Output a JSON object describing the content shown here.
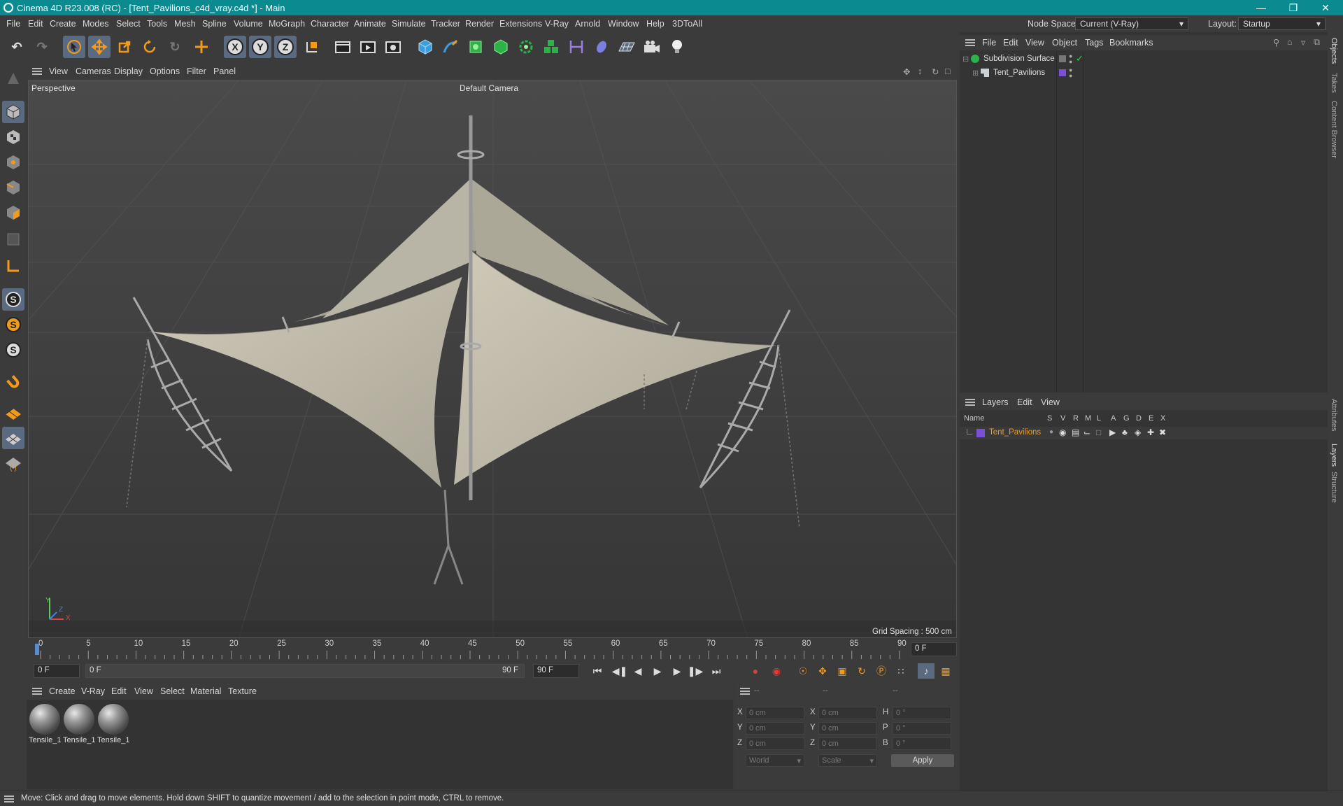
{
  "window": {
    "title": "Cinema 4D R23.008 (RC) - [Tent_Pavilions_c4d_vray.c4d *] - Main",
    "controls": [
      "—",
      "❐",
      "✕"
    ]
  },
  "menubar": {
    "items": [
      "File",
      "Edit",
      "Create",
      "Modes",
      "Select",
      "Tools",
      "Mesh",
      "Spline",
      "Volume",
      "MoGraph",
      "Character",
      "Animate",
      "Simulate",
      "Tracker",
      "Render",
      "Extensions",
      "V-Ray",
      "Arnold",
      "Window",
      "Help",
      "3DToAll"
    ],
    "node_space_label": "Node Space:",
    "node_space_value": "Current (V-Ray)",
    "layout_label": "Layout:",
    "layout_value": "Startup"
  },
  "viewport": {
    "menu": [
      "View",
      "Cameras",
      "Display",
      "Options",
      "Filter",
      "Panel"
    ],
    "projection": "Perspective",
    "camera": "Default Camera",
    "grid_spacing": "Grid Spacing : 500 cm",
    "axis_labels": {
      "y": "Y",
      "z": "Z",
      "x": "X"
    }
  },
  "timeline": {
    "ticks": [
      "0",
      "5",
      "10",
      "15",
      "20",
      "25",
      "30",
      "35",
      "40",
      "45",
      "50",
      "55",
      "60",
      "65",
      "70",
      "75",
      "80",
      "85",
      "90"
    ],
    "current_frame": "0 F",
    "start_field": "0 F",
    "range_start": "0 F",
    "range_end": "90 F",
    "end_field": "90 F"
  },
  "materials": {
    "menu": [
      "Create",
      "V-Ray",
      "Edit",
      "View",
      "Select",
      "Material",
      "Texture"
    ],
    "items": [
      "Tensile_1",
      "Tensile_1",
      "Tensile_1"
    ]
  },
  "coordinates": {
    "headers": [
      "--",
      "--",
      "--"
    ],
    "rows": [
      {
        "a": "X",
        "av": "0 cm",
        "b": "X",
        "bv": "0 cm",
        "c": "H",
        "cv": "0 °"
      },
      {
        "a": "Y",
        "av": "0 cm",
        "b": "Y",
        "bv": "0 cm",
        "c": "P",
        "cv": "0 °"
      },
      {
        "a": "Z",
        "av": "0 cm",
        "b": "Z",
        "bv": "0 cm",
        "c": "B",
        "cv": "0 °"
      }
    ],
    "world": "World",
    "scale": "Scale",
    "apply": "Apply"
  },
  "objects": {
    "menu": [
      "File",
      "Edit",
      "View",
      "Object",
      "Tags",
      "Bookmarks"
    ],
    "tree": [
      {
        "name": "Subdivision Surface"
      },
      {
        "name": "Tent_Pavilions"
      }
    ]
  },
  "layers": {
    "menu": [
      "Layers",
      "Edit",
      "View"
    ],
    "columns": [
      "Name",
      "S",
      "V",
      "R",
      "M",
      "L",
      "A",
      "G",
      "D",
      "E",
      "X"
    ],
    "rows": [
      {
        "name": "Tent_Pavilions"
      }
    ],
    "color": "#7b4fd6"
  },
  "side_tabs": [
    "Objects",
    "Takes",
    "Content Browser",
    "Attributes",
    "Layers",
    "Structure"
  ],
  "status": "Move: Click and drag to move elements. Hold down SHIFT to quantize movement / add to the selection in point mode, CTRL to remove.",
  "colors": {
    "titlebar": "#0b8a8f",
    "accent_orange": "#f29a1b",
    "selected_blue": "#5a6a80"
  }
}
